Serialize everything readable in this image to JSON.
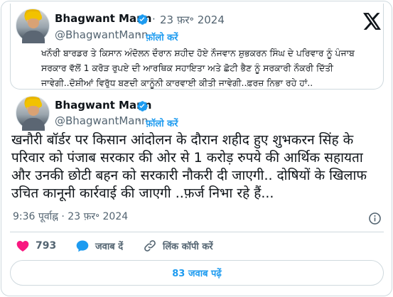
{
  "quoted_tweet": {
    "author_name": "Bhagwant Mann",
    "handle": "@BhagwantMann",
    "separator": "·",
    "date": "23 फ़र॰ 2024",
    "follow_label": "फ़ॉलो करें",
    "text": "ਖਨੌਰੀ ਬਾਰਡਰ ਤੇ ਕਿਸਾਨ ਅੰਦੋਲਨ ਦੌਰਾਨ ਸ਼ਹੀਦ ਹੋਏ ਨੌਜਵਾਨ ਸ਼ੁਭਕਰਨ ਸਿੰਘ ਦੇ ਪਰਿਵਾਰ ਨੂੰ ਪੰਜਾਬ ਸਰਕਾਰ ਵੱਲੋਂ 1 ਕਰੋੜ ਰੁਪਏ ਦੀ ਆਰਥਿਕ ਸਹਾਇਤਾ ਅਤੇ ਛੋਟੀ ਭੈਣ ਨੂੰ ਸਰਕਾਰੀ ਨੌਕਰੀ ਦਿੱਤੀ ਜਾਵੇਗੀ..ਦੋਸ਼ੀਆਂ ਵਿਰੁੱਧ ਬਣਦੀ ਕਾਨੂੰਨੀ ਕਾਰਵਾਈ ਕੀਤੀ ਜਾਵੇਗੀ..ਫ਼ਰਜ਼ ਨਿਭਾ ਰਹੇ ਹਾਂ.."
  },
  "main_tweet": {
    "author_name": "Bhagwant Mann",
    "handle": "@BhagwantMann",
    "separator": "·",
    "follow_label": "फ़ॉलो करें",
    "text": "खनौरी बॉर्डर पर किसान आंदोलन के दौरान शहीद हुए शुभकरन सिंह के परिवार को पंजाब सरकार की ओर से 1 करोड़ रुपये की आर्थिक सहायता और उनकी छोटी बहन को सरकारी नौकरी दी जाएगी.. दोषियों के खिलाफ उचित कानूनी कार्रवाई की जाएगी ..फ़र्ज निभा रहे हैं...",
    "timestamp": "9:36 पूर्वाह्न · 23 फ़र॰ 2024"
  },
  "actions": {
    "like_count": "793",
    "reply_label": "जवाब दें",
    "copy_link_label": "लिंक कॉपी करें"
  },
  "replies_button_label": "83 जवाब पढ़ें",
  "colors": {
    "accent": "#1d9bf0",
    "like": "#f91880",
    "border": "#cfd9de",
    "secondary_text": "#536471"
  },
  "icons": [
    "x-logo-icon",
    "verified-badge-icon",
    "info-icon",
    "heart-icon",
    "reply-bubble-icon",
    "link-icon"
  ]
}
